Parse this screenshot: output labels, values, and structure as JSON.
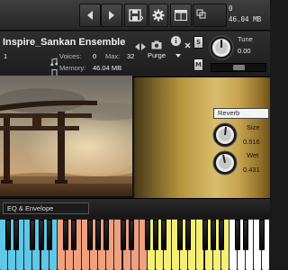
{
  "toolbar": {
    "buttons": [
      "nav-left",
      "nav-right",
      "save",
      "gear",
      "layout",
      "cpu-stats"
    ],
    "stats": {
      "cpu_label": "0",
      "memory_value": "46.04 MB"
    }
  },
  "instrument": {
    "name": "Inspire_Sankan Ensemble",
    "midi_channel": "1",
    "voices_label": "Voices:",
    "voices_value": "0",
    "max_label": "Max:",
    "max_value": "32",
    "purge_label": "Purge",
    "memory_label": "Memory:",
    "memory_value": "46.04 MB",
    "info_label": "i",
    "solo_label": "S",
    "mute_label": "M",
    "tune_label": "Tune",
    "tune_value": "0.00"
  },
  "fx": {
    "type_label": "Reverb",
    "size_label": "Size",
    "size_value": "0.516",
    "wet_label": "Wet",
    "wet_value": "0.431"
  },
  "footer": {
    "tab_label": "EQ & Envelope"
  },
  "keyboard": {
    "zone_colors": [
      "#5ec8e6",
      "#f0a07e",
      "#f5ef74",
      "#ffffff"
    ]
  }
}
